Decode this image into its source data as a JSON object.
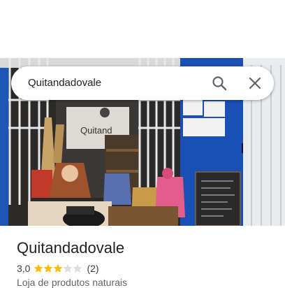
{
  "search": {
    "query": "Quitandadovale",
    "search_icon": "search-icon",
    "close_icon": "close-icon"
  },
  "photo": {
    "sign_text": "Quitand"
  },
  "place": {
    "name": "Quitandadovale",
    "rating": "3,0",
    "stars_filled": 3,
    "stars_total": 5,
    "review_count": "(2)",
    "category": "Loja de produtos naturais"
  },
  "colors": {
    "star_filled": "#fbbc04",
    "star_empty": "#dadce0",
    "door_blue": "#1a4fb5"
  }
}
